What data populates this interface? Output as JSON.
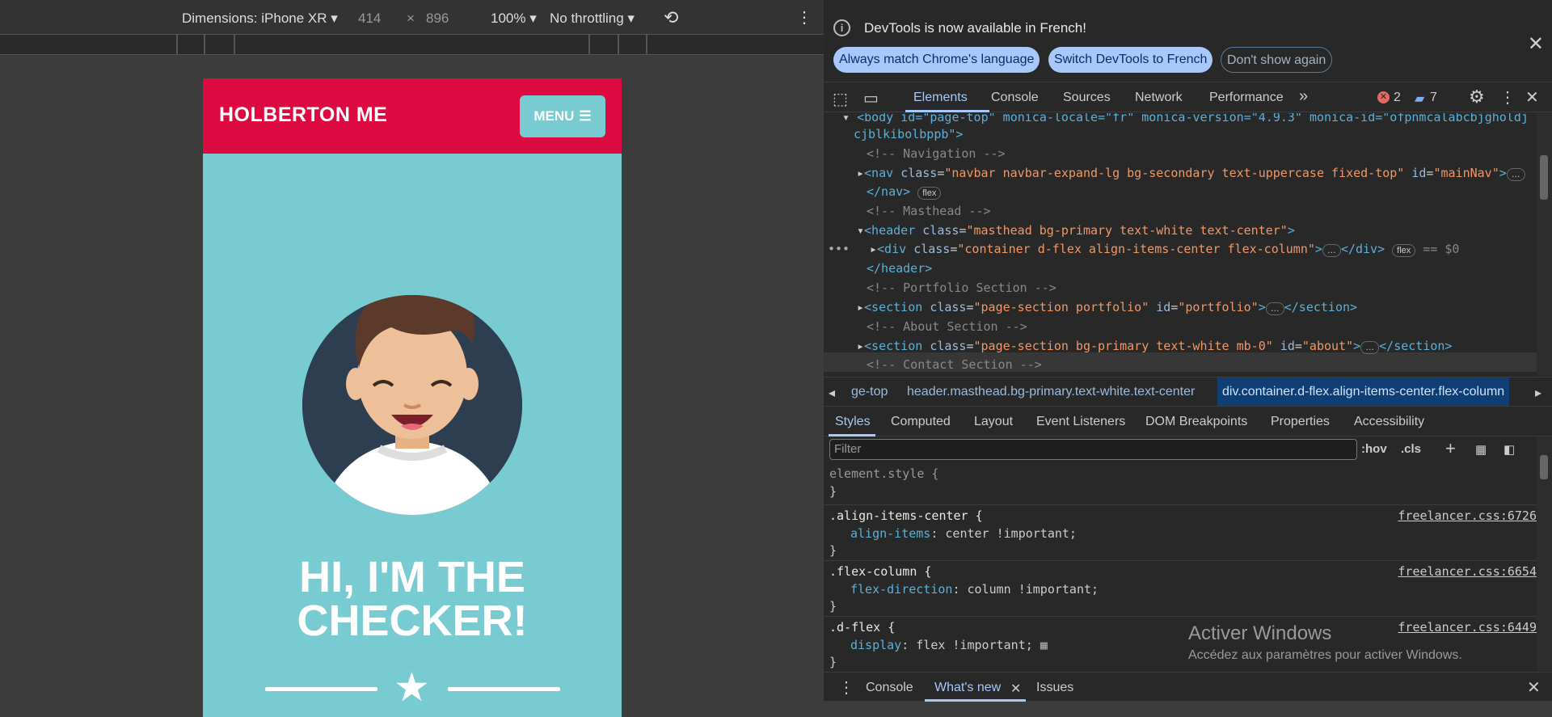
{
  "device_toolbar": {
    "dimensions_label": "Dimensions: iPhone XR",
    "width": "414",
    "times": "×",
    "height": "896",
    "zoom": "100%",
    "throttling": "No throttling"
  },
  "page": {
    "brand": "HOLBERTON ME",
    "menu_label": "MENU",
    "hero_line1": "HI, I'M THE",
    "hero_line2": "CHECKER!"
  },
  "banner": {
    "message": "DevTools is now available in French!",
    "btn_match": "Always match Chrome's language",
    "btn_switch": "Switch DevTools to French",
    "btn_dismiss": "Don't show again"
  },
  "main_tabs": [
    "Elements",
    "Console",
    "Sources",
    "Network",
    "Performance"
  ],
  "badges": {
    "errors": "2",
    "messages": "7"
  },
  "dom": {
    "body_open": "<body id=\"page-top\" monica-locale=\"fr\" monica-version=\"4.9.3\" monica-id=\"ofpnmcalabcbjgholdj",
    "body_cont": "cjblkibolbppb\">",
    "c_nav": "<!-- Navigation -->",
    "nav_tag": "<nav",
    "nav_class_attr": "class",
    "nav_class_val": "\"navbar navbar-expand-lg bg-secondary text-uppercase fixed-top\"",
    "nav_id_attr": "id",
    "nav_id_val": "\"mainNav\"",
    "nav_end": ">",
    "nav_close": "</nav>",
    "flex": "flex",
    "c_masthead": "<!-- Masthead -->",
    "header_tag": "<header",
    "header_class_attr": "class",
    "header_class_val": "\"masthead bg-primary text-white text-center\"",
    "header_end": ">",
    "div_tag": "<div",
    "div_class_attr": "class",
    "div_class_val": "\"container d-flex align-items-center flex-column\"",
    "div_end": ">",
    "div_close": "</div>",
    "dollar0": "== $0",
    "header_close": "</header>",
    "c_portfolio": "<!-- Portfolio Section -->",
    "sec1_tag": "<section",
    "sec1_class_attr": "class",
    "sec1_class_val": "\"page-section portfolio\"",
    "sec1_id_attr": "id",
    "sec1_id_val": "\"portfolio\"",
    "sec_end": ">",
    "sec_close": "</section>",
    "c_about": "<!-- About Section -->",
    "sec2_tag": "<section",
    "sec2_class_attr": "class",
    "sec2_class_val": "\"page-section bg-primary text-white mb-0\"",
    "sec2_id_attr": "id",
    "sec2_id_val": "\"about\"",
    "c_contact": "<!-- Contact Section -->"
  },
  "breadcrumbs": [
    "ge-top",
    "header.masthead.bg-primary.text-white.text-center",
    "div.container.d-flex.align-items-center.flex-column"
  ],
  "style_tabs": [
    "Styles",
    "Computed",
    "Layout",
    "Event Listeners",
    "DOM Breakpoints",
    "Properties",
    "Accessibility"
  ],
  "filter_placeholder": "Filter",
  "tools": {
    "hov": ":hov",
    "cls": ".cls"
  },
  "rules": {
    "element_style": "element.style {",
    "close": "}",
    "r1_sel": ".align-items-center {",
    "r1_prop": "align-items",
    "r1_val": ": center !important;",
    "r1_src": "freelancer.css:6726",
    "r2_sel": ".flex-column {",
    "r2_prop": "flex-direction",
    "r2_val": ": column !important;",
    "r2_src": "freelancer.css:6654",
    "r3_sel": ".d-flex {",
    "r3_prop": "display",
    "r3_val": ": flex !important;",
    "r3_src": "freelancer.css:6449"
  },
  "watermark": {
    "title": "Activer Windows",
    "subtitle": "Accédez aux paramètres pour activer Windows."
  },
  "drawer_tabs": [
    "Console",
    "What's new",
    "Issues"
  ],
  "colors": {
    "brand_red": "#dc0a40",
    "teal": "#78cbd0",
    "accent": "#a8c7fa"
  }
}
